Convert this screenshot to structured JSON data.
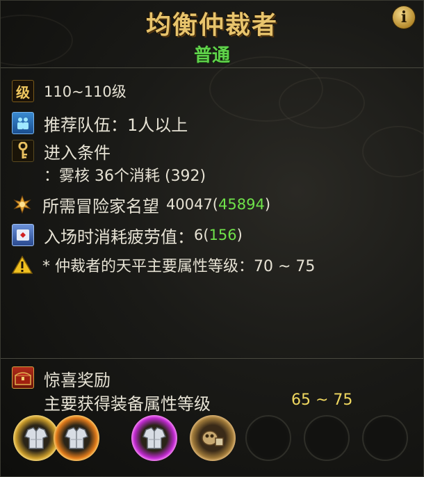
{
  "header": {
    "title": "均衡仲裁者",
    "difficulty": "普通",
    "info_icon": "info-icon"
  },
  "requirements": {
    "level": {
      "icon": "level-icon",
      "icon_text": "级",
      "value": "110~110级"
    },
    "party": {
      "icon": "party-icon",
      "label": "推荐队伍",
      "value": "：1人以上"
    },
    "entry": {
      "icon": "key-icon",
      "label": "进入条件",
      "detail": "：雾核 36个消耗 (392)"
    },
    "fame": {
      "icon": "fame-icon",
      "label": "所需冒险家名望",
      "required": "40047(",
      "current": "45894",
      "close": ")"
    },
    "fatigue": {
      "icon": "fatigue-icon",
      "label": "入场时消耗疲劳值：",
      "cost": "6(",
      "current": "156",
      "close": ")"
    },
    "attribute": {
      "icon": "warning-icon",
      "text": "* 仲裁者的天平主要属性等级：70 ~ 75"
    }
  },
  "reward": {
    "icon": "treasure-chest-icon",
    "title": "惊喜奖励",
    "description": "主要获得装备属性等级",
    "range": "65 ~ 75",
    "slots": [
      {
        "icon": "armor-icon",
        "rarity": "gold"
      },
      {
        "icon": "armor-icon",
        "rarity": "orange"
      },
      {
        "icon": "armor-icon",
        "rarity": "purple"
      },
      {
        "icon": "material-icon",
        "rarity": "brown"
      },
      {
        "icon": "empty-slot"
      },
      {
        "icon": "empty-slot"
      },
      {
        "icon": "empty-slot"
      }
    ]
  },
  "colors": {
    "title": "#e8c46c",
    "difficulty": "#5fd24a",
    "highlight": "#6fe24a",
    "range": "#f0d860"
  }
}
